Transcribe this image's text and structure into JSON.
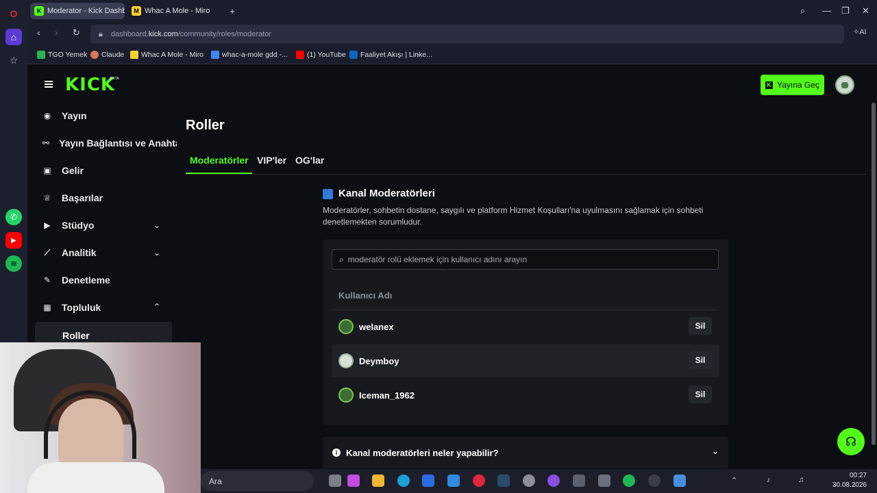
{
  "browser": {
    "tabs": [
      {
        "label": "Moderator - Kick Dashboa",
        "active": true
      },
      {
        "label": "Whac A Mole - Miro",
        "active": false
      }
    ],
    "url_prefix": "dashboard.",
    "url_domain": "kick.com",
    "url_path": "/community/roles/moderator",
    "ai_label": "AI",
    "bookmarks": [
      "TGO Yemek",
      "Claude",
      "Whac A Mole - Miro",
      "whac-a-mole gdd -...",
      "(1) YouTube",
      "Faaliyet Akışı | Linke..."
    ]
  },
  "header": {
    "logo": "KICK",
    "logo_badge": "BETA",
    "go_live_label": "Yayına Geç"
  },
  "sidebar": {
    "items": [
      {
        "label": "Yayın",
        "icon": "broadcast-icon"
      },
      {
        "label": "Yayın Bağlantısı ve Anahtar",
        "icon": "link-icon"
      },
      {
        "label": "Gelir",
        "icon": "revenue-icon"
      },
      {
        "label": "Başarılar",
        "icon": "trophy-icon"
      },
      {
        "label": "Stüdyo",
        "icon": "studio-icon"
      },
      {
        "label": "Analitik",
        "icon": "analytics-icon"
      },
      {
        "label": "Denetleme",
        "icon": "wrench-icon"
      },
      {
        "label": "Topluluk",
        "icon": "community-icon"
      }
    ],
    "sub_item": "Roller"
  },
  "main": {
    "title": "Roller",
    "tabs": [
      "Moderatörler",
      "VIP'ler",
      "OG'lar"
    ],
    "section_title": "Kanal Moderatörleri",
    "section_desc": "Moderatörler, sohbetin dostane, saygılı ve platform Hizmet Koşulları'na uyulmasını sağlamak için sohbeti denetlemekten sorumludur.",
    "search_placeholder": "moderatör rolü eklemek için kullanıcı adını arayın",
    "column_header": "Kullanıcı Adı",
    "moderators": [
      {
        "username": "welanex",
        "action": "Sil"
      },
      {
        "username": "Deymboy",
        "action": "Sil"
      },
      {
        "username": "Iceman_1962",
        "action": "Sil"
      }
    ],
    "faq_title": "Kanal moderatörleri neler yapabilir?"
  },
  "taskbar": {
    "search_label": "Ara",
    "time": "00:27",
    "date": "30.08.2026"
  },
  "colors": {
    "kick_green": "#53fc18",
    "background": "#0b0e12",
    "card": "#17191e"
  }
}
